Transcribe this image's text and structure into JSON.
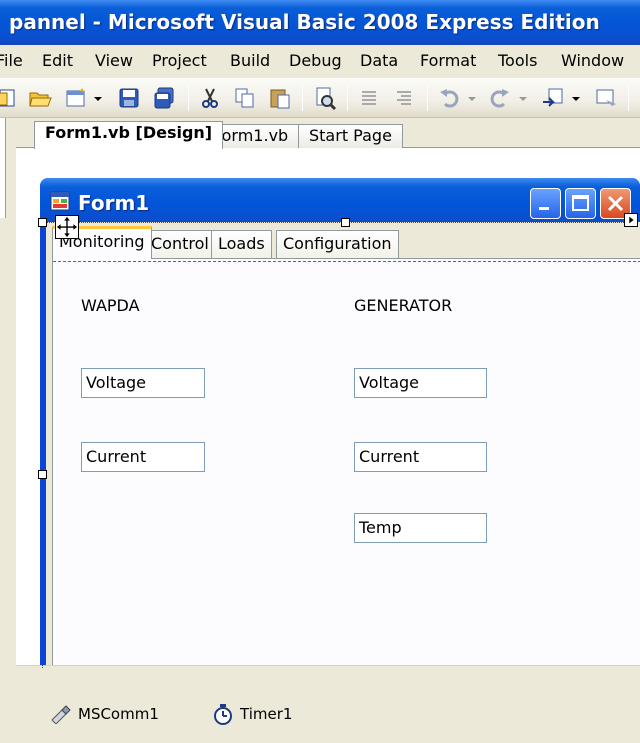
{
  "window": {
    "title": "pannel - Microsoft Visual Basic 2008 Express Edition"
  },
  "menu": [
    "File",
    "Edit",
    "View",
    "Project",
    "Build",
    "Debug",
    "Data",
    "Format",
    "Tools",
    "Window"
  ],
  "toolbar": {
    "icons": [
      "add-item-icon",
      "open-icon",
      "add-new-item-icon",
      "save-icon",
      "save-all-icon",
      "cut-icon",
      "copy-icon",
      "paste-icon",
      "find-icon",
      "comment-icon",
      "uncomment-icon",
      "undo-icon",
      "redo-icon",
      "navigate-icon",
      "start-icon"
    ]
  },
  "doc_tabs": [
    "Form1.vb [Design]",
    "Form1.vb",
    "Start Page"
  ],
  "form": {
    "title": "Form1",
    "tabs": [
      "Monitoring",
      "Control",
      "Loads",
      "Configuration"
    ],
    "wapda": {
      "heading": "WAPDA",
      "voltage": "Voltage",
      "current": "Current"
    },
    "generator": {
      "heading": "GENERATOR",
      "voltage": "Voltage",
      "current": "Current",
      "temp": "Temp"
    }
  },
  "tray": [
    "MSComm1",
    "Timer1"
  ],
  "colors": {
    "title_blue": "#0356d6",
    "tab_highlight": "#ffc83c",
    "close_red": "#d84820"
  }
}
